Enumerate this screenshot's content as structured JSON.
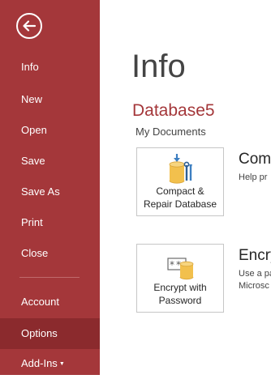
{
  "colors": {
    "accent": "#a4373a",
    "accent_selected": "#8b2a2d",
    "text_dark": "#444444"
  },
  "sidebar": {
    "back_icon": "back-arrow-icon",
    "items": [
      {
        "label": "Info"
      },
      {
        "label": "New"
      },
      {
        "label": "Open"
      },
      {
        "label": "Save"
      },
      {
        "label": "Save As"
      },
      {
        "label": "Print"
      },
      {
        "label": "Close"
      },
      {
        "label": "Account"
      },
      {
        "label": "Options"
      },
      {
        "label": "Add-Ins"
      }
    ],
    "selected": "Options"
  },
  "main": {
    "title": "Info",
    "database_name": "Database5",
    "database_location": "My Documents",
    "compact": {
      "icon": "compact-repair-icon",
      "button_line1": "Compact &",
      "button_line2": "Repair Database",
      "heading": "Com",
      "description": "Help pr"
    },
    "encrypt": {
      "icon": "encrypt-lock-icon",
      "button_line1": "Encrypt with",
      "button_line2": "Password",
      "heading": "Encry",
      "description_line1": "Use a pa",
      "description_line2": "Microsc"
    }
  }
}
